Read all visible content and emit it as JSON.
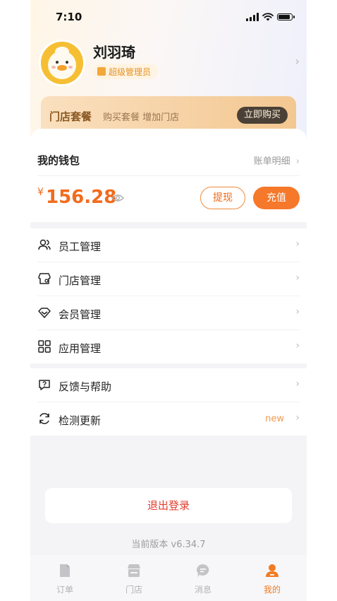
{
  "status_bar": {
    "time": "7:10"
  },
  "profile": {
    "name": "刘羽琦",
    "role": "超级管理员"
  },
  "banner": {
    "title": "门店套餐",
    "subtitle": "购买套餐 增加门店",
    "button": "立即购买"
  },
  "wallet": {
    "title": "我的钱包",
    "details_link": "账单明细",
    "currency": "¥",
    "balance": "156.28",
    "withdraw": "提现",
    "recharge": "充值"
  },
  "menu_group_1": [
    {
      "label": "员工管理",
      "icon": "staff-icon"
    },
    {
      "label": "门店管理",
      "icon": "store-icon"
    },
    {
      "label": "会员管理",
      "icon": "member-icon"
    },
    {
      "label": "应用管理",
      "icon": "apps-icon"
    }
  ],
  "menu_group_2": [
    {
      "label": "反馈与帮助",
      "icon": "feedback-icon"
    },
    {
      "label": "检测更新",
      "icon": "refresh-icon",
      "badge": "new"
    }
  ],
  "logout": "退出登录",
  "version": "当前版本 v6.34.7",
  "tabs": [
    {
      "label": "订单",
      "icon": "order-icon"
    },
    {
      "label": "门店",
      "icon": "store-tab-icon"
    },
    {
      "label": "消息",
      "icon": "message-icon"
    },
    {
      "label": "我的",
      "icon": "me-icon",
      "active": true
    }
  ],
  "colors": {
    "accent": "#f6782a",
    "price": "#f26b1d",
    "logout": "#e23c2d"
  }
}
